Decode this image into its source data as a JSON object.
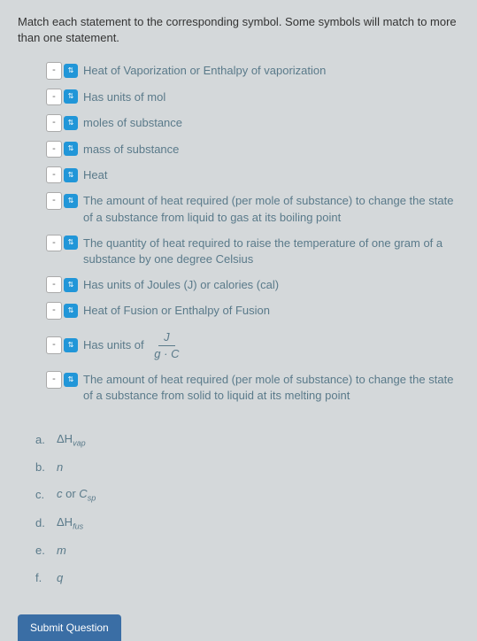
{
  "instruction": "Match each statement to the corresponding symbol. Some symbols will match to more than one statement.",
  "selectPlaceholder": "-",
  "statements": {
    "s1": "Heat of Vaporization or Enthalpy of vaporization",
    "s2": "Has units of mol",
    "s3": "moles of substance",
    "s4": "mass of substance",
    "s5": "Heat",
    "s6": "The amount of heat required (per mole of substance) to change the state of a substance from liquid to gas at its boiling point",
    "s7": "The quantity of heat required to raise the temperature of one gram of a substance by one degree Celsius",
    "s8": "Has units of Joules (J) or calories (cal)",
    "s9": "Heat of Fusion or Enthalpy of Fusion",
    "s10_prefix": "Has units of",
    "s10_num": "J",
    "s10_den": "g · C",
    "s11": "The amount of heat required (per mole of substance) to change the state of a substance from solid to liquid at its melting point"
  },
  "answers": {
    "a": {
      "letter": "a.",
      "symbol": "ΔH",
      "sub": "vap"
    },
    "b": {
      "letter": "b.",
      "symbol": "n",
      "sub": ""
    },
    "c": {
      "letter": "c.",
      "symbol": "c",
      "extra": " or ",
      "symbol2": "C",
      "sub2": "sp"
    },
    "d": {
      "letter": "d.",
      "symbol": "ΔH",
      "sub": "fus"
    },
    "e": {
      "letter": "e.",
      "symbol": "m",
      "sub": ""
    },
    "f": {
      "letter": "f.",
      "symbol": "q",
      "sub": ""
    }
  },
  "submitLabel": "Submit Question"
}
